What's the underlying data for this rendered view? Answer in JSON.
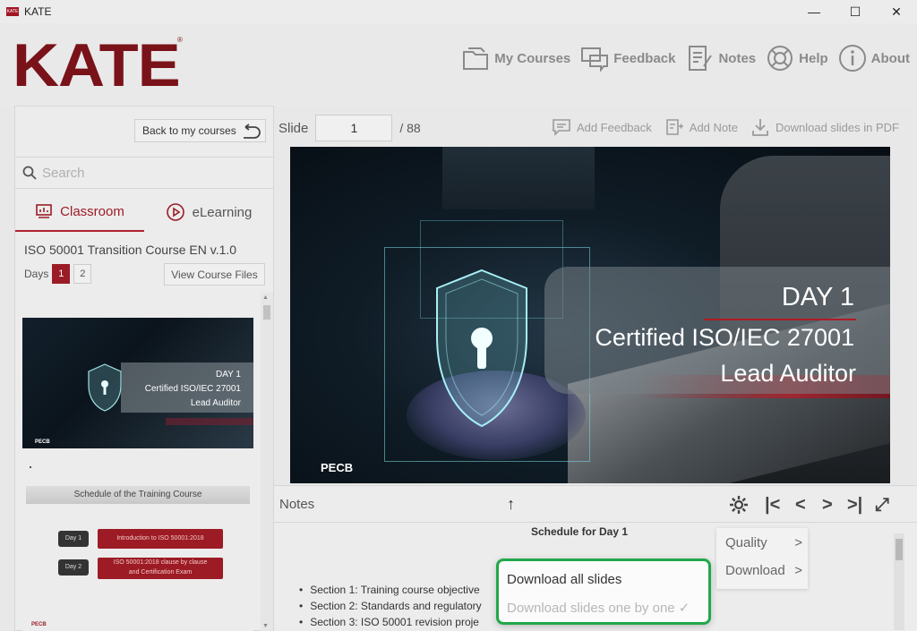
{
  "window": {
    "app_icon_text": "KATE",
    "title": "KATE",
    "min": "—",
    "max": "☐",
    "close": "✕"
  },
  "header": {
    "logo": "KATE",
    "nav": [
      {
        "label": "My Courses",
        "icon": "folder-icon"
      },
      {
        "label": "Feedback",
        "icon": "chat-icon"
      },
      {
        "label": "Notes",
        "icon": "notes-icon"
      },
      {
        "label": "Help",
        "icon": "lifebuoy-icon"
      },
      {
        "label": "About",
        "icon": "info-icon"
      }
    ]
  },
  "sidebar": {
    "back_label": "Back to my courses",
    "search_placeholder": "Search",
    "tabs": [
      {
        "label": "Classroom",
        "active": true
      },
      {
        "label": "eLearning",
        "active": false
      }
    ],
    "course_title": "ISO 50001 Transition Course  EN v.1.0",
    "days_label": "Days",
    "days": [
      "1",
      "2"
    ],
    "active_day": "1",
    "view_files_label": "View Course Files",
    "thumb1": {
      "line1": "DAY 1",
      "line2": "Certified ISO/IEC 27001",
      "line3": "Lead Auditor",
      "brand": "PECB"
    },
    "thumb2": {
      "header": "Schedule of the Training Course",
      "day1": "Day 1",
      "day2": "Day 2",
      "bar1": "Introduction to ISO 50001:2018",
      "bar2a": "ISO 50001:2018 clause by clause",
      "bar2b": "and Certification Exam",
      "brand": "PECB"
    }
  },
  "slidebar": {
    "label": "Slide",
    "current": "1",
    "total": "/ 88",
    "add_feedback": "Add Feedback",
    "add_note": "Add Note",
    "download_pdf": "Download slides in PDF"
  },
  "slide": {
    "line1": "DAY 1",
    "line2": "Certified ISO/IEC 27001",
    "line3": "Lead Auditor",
    "brand": "PECB"
  },
  "notesbar": {
    "label": "Notes",
    "up": "↑",
    "first": "|<",
    "prev": "<",
    "next": ">",
    "last": ">|",
    "fullscreen": "⤢"
  },
  "notes": {
    "heading": "Schedule for Day 1",
    "items": [
      "Section 1: Training course objective",
      "Section 2: Standards and regulatory",
      "Section 3: ISO 50001 revision proje"
    ]
  },
  "settings_menu": {
    "quality": "Quality",
    "download": "Download",
    "chevron": ">"
  },
  "download_menu": {
    "all": "Download all slides",
    "one_by_one": "Download slides one by one ✓"
  },
  "colors": {
    "brand": "#7a1219",
    "accent": "#b02030",
    "highlight": "#21a84a"
  }
}
